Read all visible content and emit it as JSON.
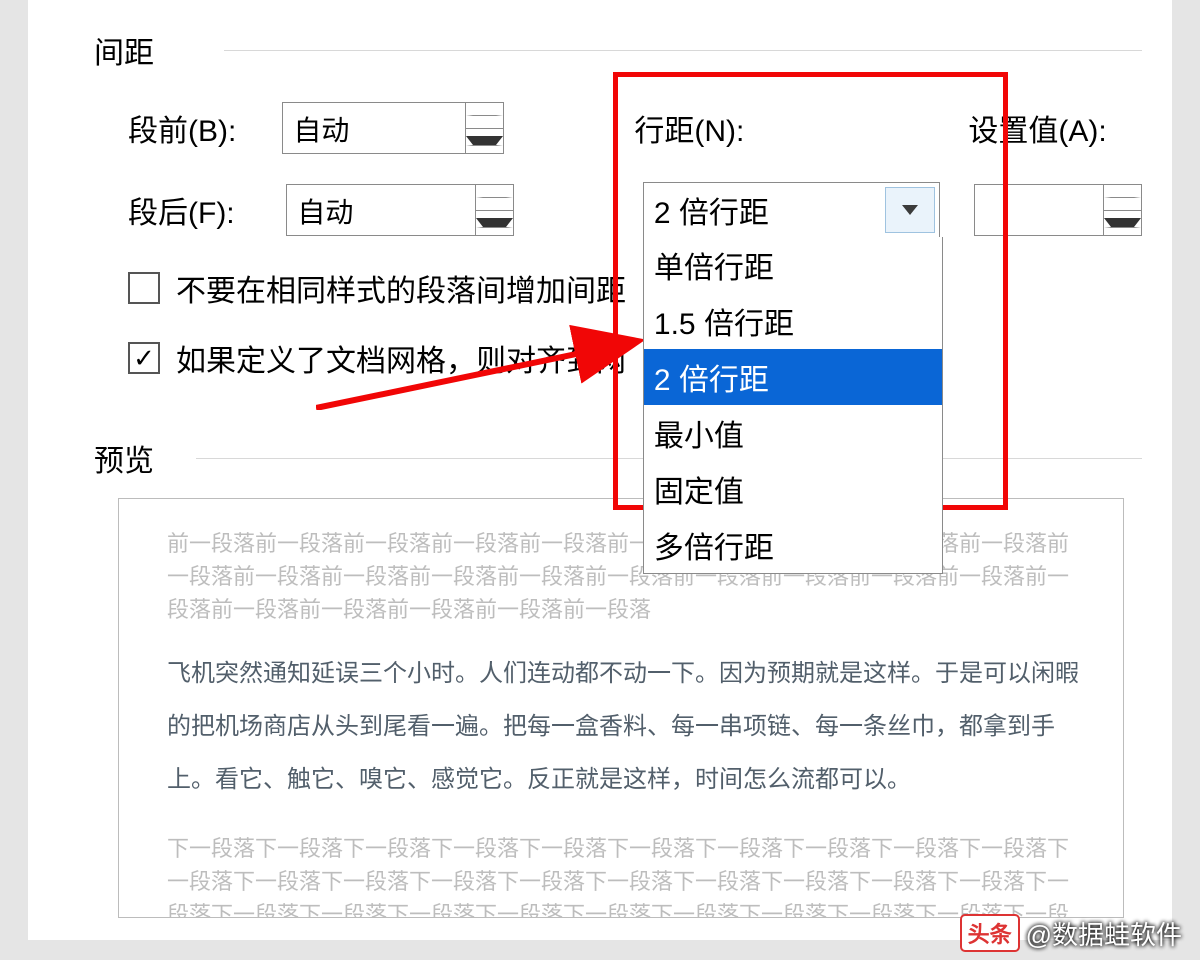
{
  "section_spacing": "间距",
  "labels": {
    "before": "段前(B):",
    "after": "段后(F):",
    "line_spacing": "行距(N):",
    "set_value": "设置值(A):"
  },
  "spin_before": "自动",
  "spin_after": "自动",
  "set_value": "",
  "combo_selected": "2 倍行距",
  "combo_options": [
    "单倍行距",
    "1.5 倍行距",
    "2 倍行距",
    "最小值",
    "固定值",
    "多倍行距"
  ],
  "combo_selected_index": 2,
  "chk1": {
    "checked": false,
    "label": "不要在相同样式的段落间增加间距"
  },
  "chk2": {
    "checked": true,
    "label": "如果定义了文档网格，则对齐到网"
  },
  "preview_title": "预览",
  "preview": {
    "prev_gray": "前一段落前一段落前一段落前一段落前一段落前一段落前一段落前一段落前一段落前一段落前一段落前一段落前一段落前一段落前一段落前一段落前一段落前一段落前一段落前一段落前一段落前一段落前一段落前一段落前一段落前一段落",
    "body": "飞机突然通知延误三个小时。人们连动都不动一下。因为预期就是这样。于是可以闲暇的把机场商店从头到尾看一遍。把每一盒香料、每一串项链、每一条丝巾，都拿到手上。看它、触它、嗅它、感觉它。反正就是这样，时间怎么流都可以。",
    "next_gray": "下一段落下一段落下一段落下一段落下一段落下一段落下一段落下一段落下一段落下一段落下一段落下一段落下一段落下一段落下一段落下一段落下一段落下一段落下一段落下一段落下一段落下一段落下一段落下一段落下一段落下一段落下一段落下一段落下一段落下一段落下一段落下一段落下"
  },
  "watermark": {
    "badge": "头条",
    "text": "@数据蛙软件"
  }
}
